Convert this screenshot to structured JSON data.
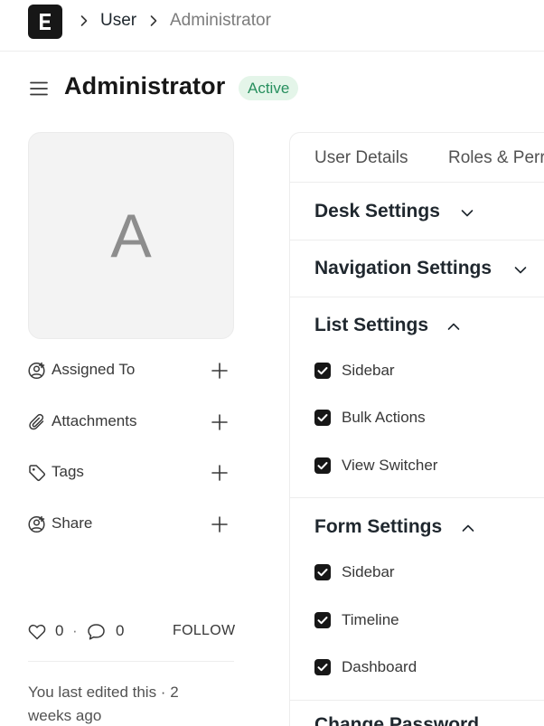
{
  "navbar": {
    "breadcrumbs": [
      "User",
      "Administrator"
    ]
  },
  "header": {
    "title": "Administrator",
    "status": "Active"
  },
  "sidebar": {
    "avatar_letter": "A",
    "items": [
      {
        "label": "Assigned To",
        "icon": "assign-user-icon"
      },
      {
        "label": "Attachments",
        "icon": "paperclip-icon"
      },
      {
        "label": "Tags",
        "icon": "tag-icon"
      },
      {
        "label": "Share",
        "icon": "share-user-icon"
      }
    ],
    "likes": "0",
    "separator": "·",
    "comments": "0",
    "follow_label": "FOLLOW",
    "last_edited": "You last edited this · 2 weeks ago"
  },
  "tabs": [
    "User Details",
    "Roles & Perr"
  ],
  "sections": {
    "desk": {
      "title": "Desk Settings",
      "expanded": false
    },
    "navigation": {
      "title": "Navigation Settings",
      "expanded": false
    },
    "list": {
      "title": "List Settings",
      "expanded": true,
      "checks": [
        {
          "label": "Sidebar",
          "checked": true
        },
        {
          "label": "Bulk Actions",
          "checked": true
        },
        {
          "label": "View Switcher",
          "checked": true
        }
      ]
    },
    "form": {
      "title": "Form Settings",
      "expanded": true,
      "checks": [
        {
          "label": "Sidebar",
          "checked": true
        },
        {
          "label": "Timeline",
          "checked": true
        },
        {
          "label": "Dashboard",
          "checked": true
        }
      ]
    },
    "next_title_partial": "Change Password"
  },
  "colors": {
    "status_bg": "#e4f5e9",
    "status_text": "#278f5e",
    "checkbox": "#171717"
  }
}
